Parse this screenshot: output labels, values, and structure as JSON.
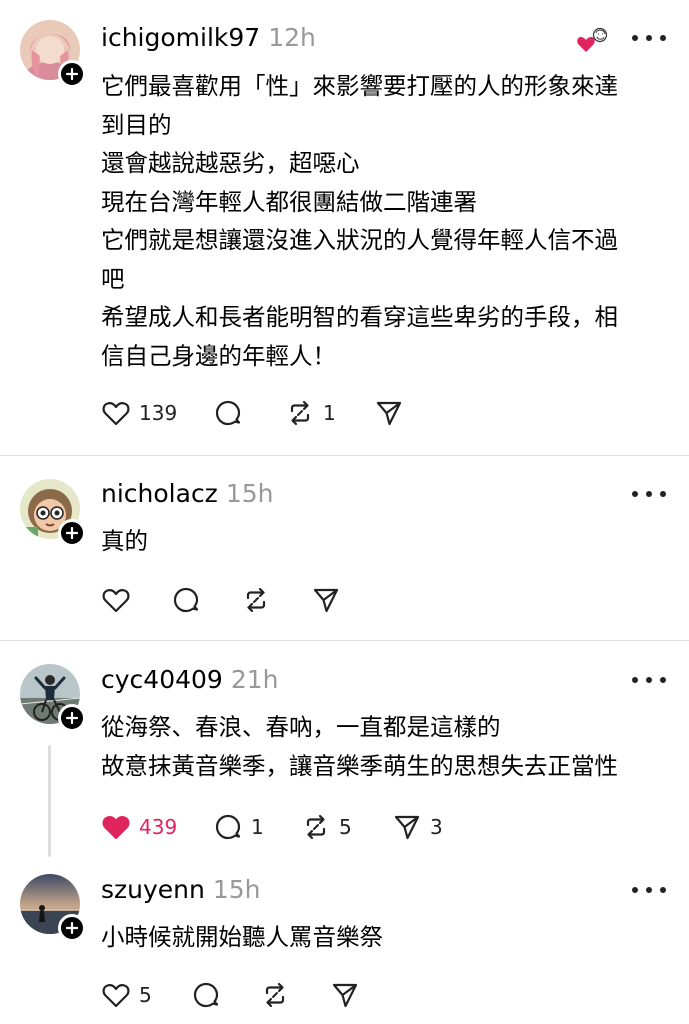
{
  "posts": [
    {
      "username": "ichigomilk97",
      "time": "12h",
      "text": "它們最喜歡用「性」來影響要打壓的人的形象來達\n到目的\n還會越說越惡劣，超噁心\n現在台灣年輕人都很團結做二階連署\n它們就是想讓還沒進入狀況的人覺得年輕人信不過\n吧\n希望成人和長者能明智的看穿這些卑劣的手段，相\n信自己身邊的年輕人！",
      "likes": "139",
      "comments": "",
      "reposts": "1",
      "shares": "",
      "liked": false
    },
    {
      "username": "nicholacz",
      "time": "15h",
      "text": "真的",
      "likes": "",
      "comments": "",
      "reposts": "",
      "shares": "",
      "liked": false
    },
    {
      "username": "cyc40409",
      "time": "21h",
      "text": "從海祭、春浪、春吶，一直都是這樣的\n故意抹黃音樂季，讓音樂季萌生的思想失去正當性",
      "likes": "439",
      "comments": "1",
      "reposts": "5",
      "shares": "3",
      "liked": true
    },
    {
      "username": "szuyenn",
      "time": "15h",
      "text": "小時候就開始聽人罵音樂祭",
      "likes": "5",
      "comments": "",
      "reposts": "",
      "shares": "",
      "liked": false
    }
  ],
  "icons": {
    "like": "heart-icon",
    "comment": "comment-bubble-icon",
    "repost": "repost-icon",
    "share": "share-send-icon",
    "more": "more-dots-icon",
    "follow": "plus-icon"
  },
  "colors": {
    "like_active": "#e0245e",
    "time": "#999999",
    "divider": "#e3e3e3"
  }
}
